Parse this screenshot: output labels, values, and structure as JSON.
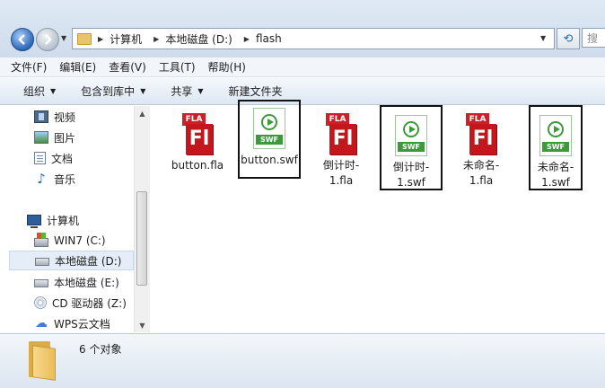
{
  "address": {
    "crumbs": [
      "计算机",
      "本地磁盘 (D:)",
      "flash"
    ],
    "search_placeholder": "搜"
  },
  "menu": [
    "文件(F)",
    "编辑(E)",
    "查看(V)",
    "工具(T)",
    "帮助(H)"
  ],
  "commands": {
    "organize": "组织",
    "include_in_library": "包含到库中",
    "share": "共享",
    "new_folder": "新建文件夹"
  },
  "nav": {
    "libraries": [
      "视频",
      "图片",
      "文档",
      "音乐"
    ],
    "computer_label": "计算机",
    "drives": [
      "WIN7 (C:)",
      "本地磁盘 (D:)",
      "本地磁盘 (E:)",
      "CD 驱动器 (Z:)",
      "WPS云文档"
    ],
    "selected": "本地磁盘 (D:)"
  },
  "files": [
    {
      "name": "button.fla",
      "type": "fla",
      "icon_tab": "FLA",
      "icon_mark": "Fl",
      "highlighted": false
    },
    {
      "name": "button.swf",
      "type": "swf",
      "icon_label": "SWF",
      "highlighted": true
    },
    {
      "name": "倒计时-1.fla",
      "type": "fla",
      "icon_tab": "FLA",
      "icon_mark": "Fl",
      "highlighted": false
    },
    {
      "name": "倒计时-1.swf",
      "type": "swf",
      "icon_label": "SWF",
      "highlighted": true
    },
    {
      "name": "未命名-1.fla",
      "type": "fla",
      "icon_tab": "FLA",
      "icon_mark": "Fl",
      "highlighted": false
    },
    {
      "name": "未命名-1.swf",
      "type": "swf",
      "icon_label": "SWF",
      "highlighted": true
    }
  ],
  "status": {
    "count_text": "6 个对象"
  },
  "colors": {
    "fla_red": "#c4161d",
    "swf_green": "#3d9a3a",
    "selection": "#e5eef8"
  }
}
